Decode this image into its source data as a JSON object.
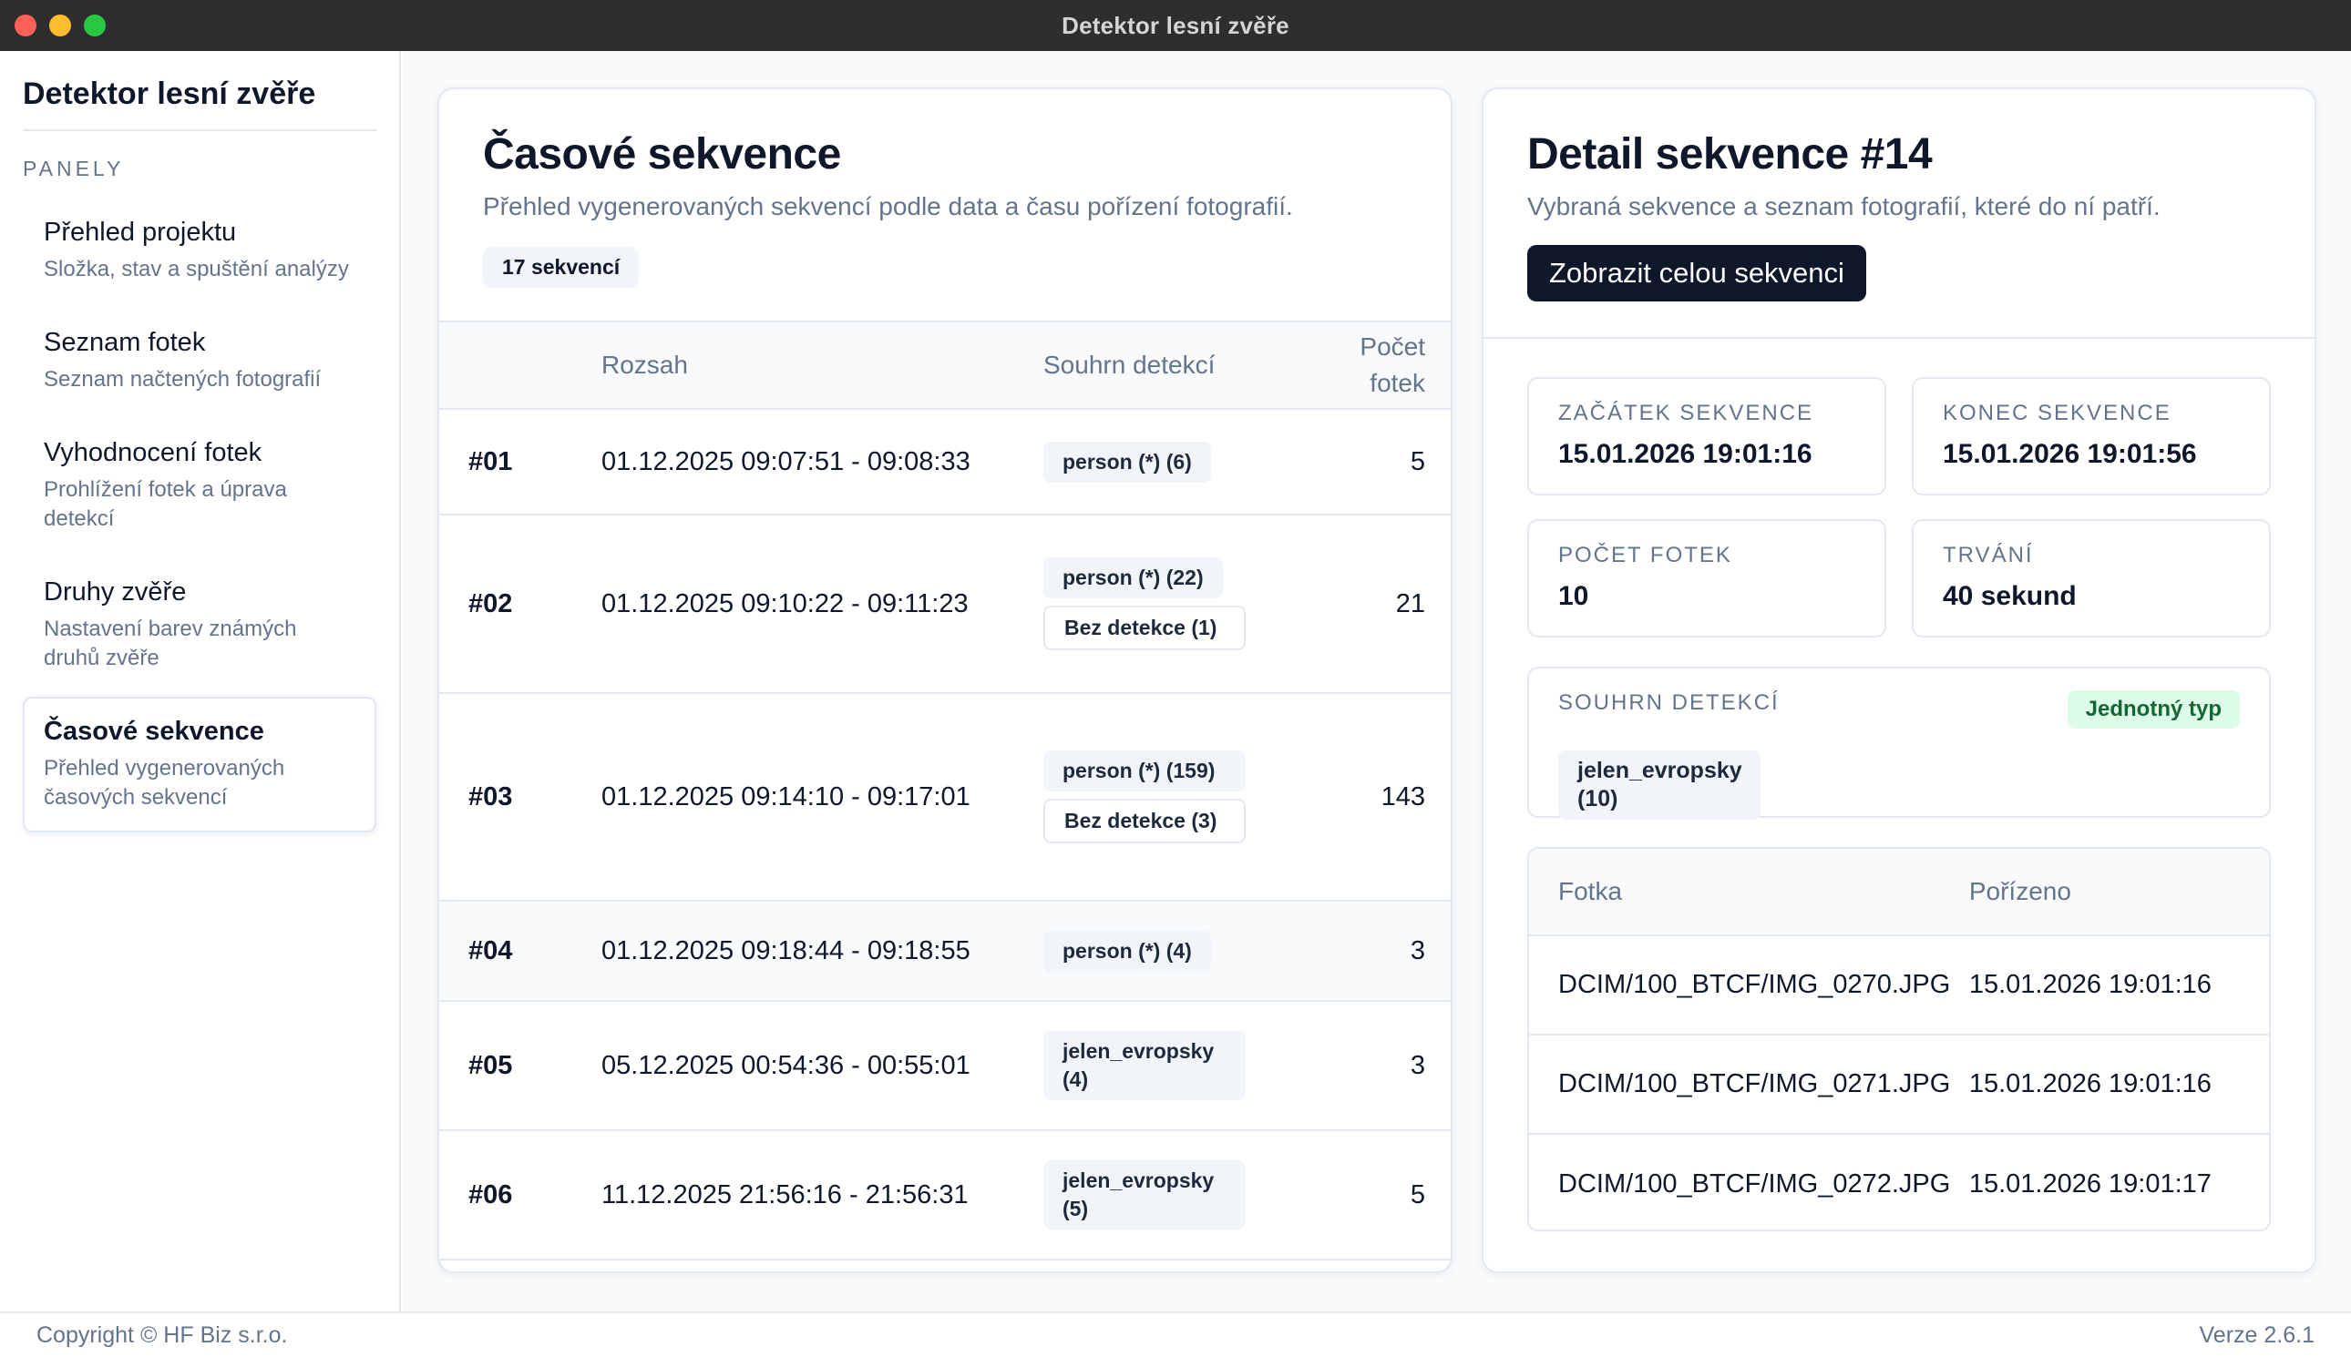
{
  "window": {
    "title": "Detektor lesní zvěře"
  },
  "sidebar": {
    "app_name": "Detektor lesní zvěře",
    "section_label": "PANELY",
    "items": [
      {
        "title": "Přehled projektu",
        "desc": "Složka, stav a spuštění analýzy"
      },
      {
        "title": "Seznam fotek",
        "desc": "Seznam načtených fotografií"
      },
      {
        "title": "Vyhodnocení fotek",
        "desc": "Prohlížení fotek a úprava detekcí"
      },
      {
        "title": "Druhy zvěře",
        "desc": "Nastavení barev známých druhů zvěře"
      },
      {
        "title": "Časové sekvence",
        "desc": "Přehled vygenerovaných časových sekvencí",
        "active": true
      }
    ]
  },
  "sequences": {
    "title": "Časové sekvence",
    "subtitle": "Přehled vygenerovaných sekvencí podle data a času pořízení fotografií.",
    "count_badge": "17 sekvencí",
    "columns": {
      "id": "",
      "range": "Rozsah",
      "detections": "Souhrn detekcí",
      "count": "Počet fotek"
    },
    "rows": [
      {
        "id": "#01",
        "range": "01.12.2025 09:07:51 - 09:08:33",
        "detections": [
          "person (*) (6)"
        ],
        "count": "5"
      },
      {
        "id": "#02",
        "range": "01.12.2025 09:10:22 - 09:11:23",
        "detections": [
          "person (*) (22)",
          "Bez detekce (1)"
        ],
        "count": "21"
      },
      {
        "id": "#03",
        "range": "01.12.2025 09:14:10 - 09:17:01",
        "detections": [
          "person (*) (159)",
          "Bez detekce (3)"
        ],
        "count": "143"
      },
      {
        "id": "#04",
        "range": "01.12.2025 09:18:44 - 09:18:55",
        "detections": [
          "person (*) (4)"
        ],
        "count": "3"
      },
      {
        "id": "#05",
        "range": "05.12.2025 00:54:36 - 00:55:01",
        "detections": [
          "jelen_evropsky (4)"
        ],
        "count": "3"
      },
      {
        "id": "#06",
        "range": "11.12.2025 21:56:16 - 21:56:31",
        "detections": [
          "jelen_evropsky (5)"
        ],
        "count": "5"
      }
    ]
  },
  "detail": {
    "title": "Detail sekvence #14",
    "subtitle": "Vybraná sekvence a seznam fotografií, které do ní patří.",
    "show_button": "Zobrazit celou sekvenci",
    "start_label": "ZAČÁTEK SEKVENCE",
    "start_value": "15.01.2026 19:01:16",
    "end_label": "KONEC SEKVENCE",
    "end_value": "15.01.2026 19:01:56",
    "photo_count_label": "POČET FOTEK",
    "photo_count_value": "10",
    "duration_label": "TRVÁNÍ",
    "duration_value": "40 sekund",
    "summary_label": "SOUHRN DETEKCÍ",
    "summary_badge": "Jednotný typ",
    "summary_chip": "jelen_evropsky (10)",
    "photo_columns": {
      "file": "Fotka",
      "taken": "Pořízeno"
    },
    "photos": [
      {
        "file": "DCIM/100_BTCF/IMG_0270.JPG",
        "taken": "15.01.2026 19:01:16"
      },
      {
        "file": "DCIM/100_BTCF/IMG_0271.JPG",
        "taken": "15.01.2026 19:01:16"
      },
      {
        "file": "DCIM/100_BTCF/IMG_0272.JPG",
        "taken": "15.01.2026 19:01:17"
      }
    ]
  },
  "footer": {
    "copyright": "Copyright © HF Biz s.r.o.",
    "version": "Verze 2.6.1"
  },
  "colors": {
    "accent": "#0f172a",
    "success_bg": "#dcfce7",
    "success_text": "#166534"
  }
}
